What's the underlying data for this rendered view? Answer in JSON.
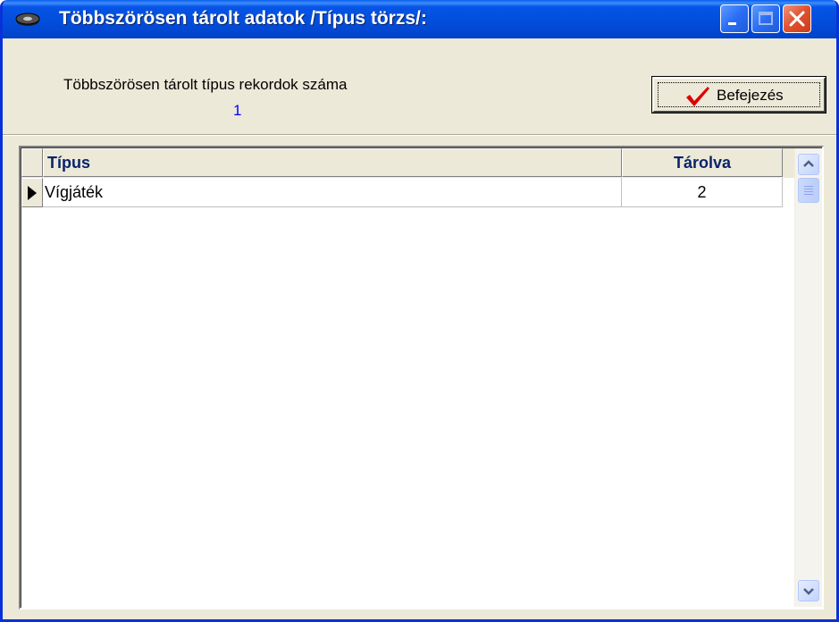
{
  "window": {
    "title": "Többszörösen tárolt adatok /Típus törzs/:",
    "title_icon": "disk-icon",
    "controls": [
      "minimize-icon",
      "maximize-icon",
      "close-icon"
    ],
    "accent_color": "#0054E3",
    "close_color": "#E0512E"
  },
  "summary": {
    "count_label": "Többszörösen tárolt típus rekordok száma",
    "count_value": "1",
    "count_value_color": "#0000FF"
  },
  "finish_button": {
    "label": "Befejezés",
    "icon": "checkmark-icon",
    "icon_color": "#E00000"
  },
  "grid": {
    "columns": [
      "Típus",
      "Tárolva"
    ],
    "rows": [
      {
        "tipus": "Vígjáték",
        "tarolva": "2",
        "current": true
      }
    ],
    "scrollbar": {
      "up_icon": "chevron-up-icon",
      "down_icon": "chevron-down-icon"
    }
  }
}
